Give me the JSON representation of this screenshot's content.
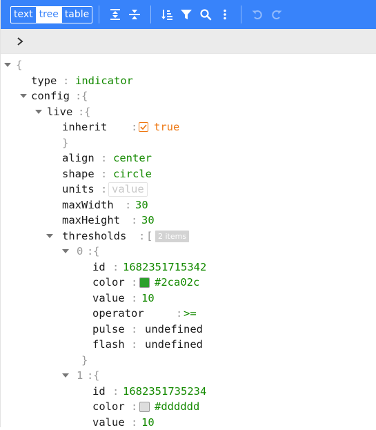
{
  "toolbar": {
    "modes": [
      {
        "label": "text",
        "active": false
      },
      {
        "label": "tree",
        "active": true
      },
      {
        "label": "table",
        "active": false
      }
    ],
    "icons": [
      "expand-all-icon",
      "collapse-all-icon",
      "sort-icon",
      "filter-icon",
      "search-icon",
      "more-icon",
      "undo-icon",
      "redo-icon"
    ],
    "background_color": "#3883fa"
  },
  "navbar": {
    "icon": "chevron-right-icon"
  },
  "tree": {
    "root_open": "{",
    "type_key": "type",
    "type_value": "indicator",
    "config_key": "config",
    "config_open": "{",
    "live_key": "live",
    "live_open": "{",
    "inherit_key": "inherit",
    "inherit_value": "true",
    "live_close": "}",
    "align_key": "align",
    "align_value": "center",
    "shape_key": "shape",
    "shape_value": "circle",
    "units_key": "units",
    "units_placeholder": "value",
    "maxwidth_key": "maxWidth",
    "maxwidth_value": "30",
    "maxheight_key": "maxHeight",
    "maxheight_value": "30",
    "thresholds_key": "thresholds",
    "thresholds_open": "[",
    "thresholds_count": "2 items",
    "items": [
      {
        "index": "0",
        "open": "{",
        "id_key": "id",
        "id_value": "1682351715342",
        "color_key": "color",
        "color_value": "#2ca02c",
        "value_key": "value",
        "value_value": "10",
        "operator_key": "operator",
        "operator_value": ">=",
        "pulse_key": "pulse",
        "pulse_value": "undefined",
        "flash_key": "flash",
        "flash_value": "undefined",
        "close": "}"
      },
      {
        "index": "1",
        "open": "{",
        "id_key": "id",
        "id_value": "1682351735234",
        "color_key": "color",
        "color_value": "#dddddd",
        "value_key": "value",
        "value_value": "10"
      }
    ],
    "separator": ":"
  }
}
